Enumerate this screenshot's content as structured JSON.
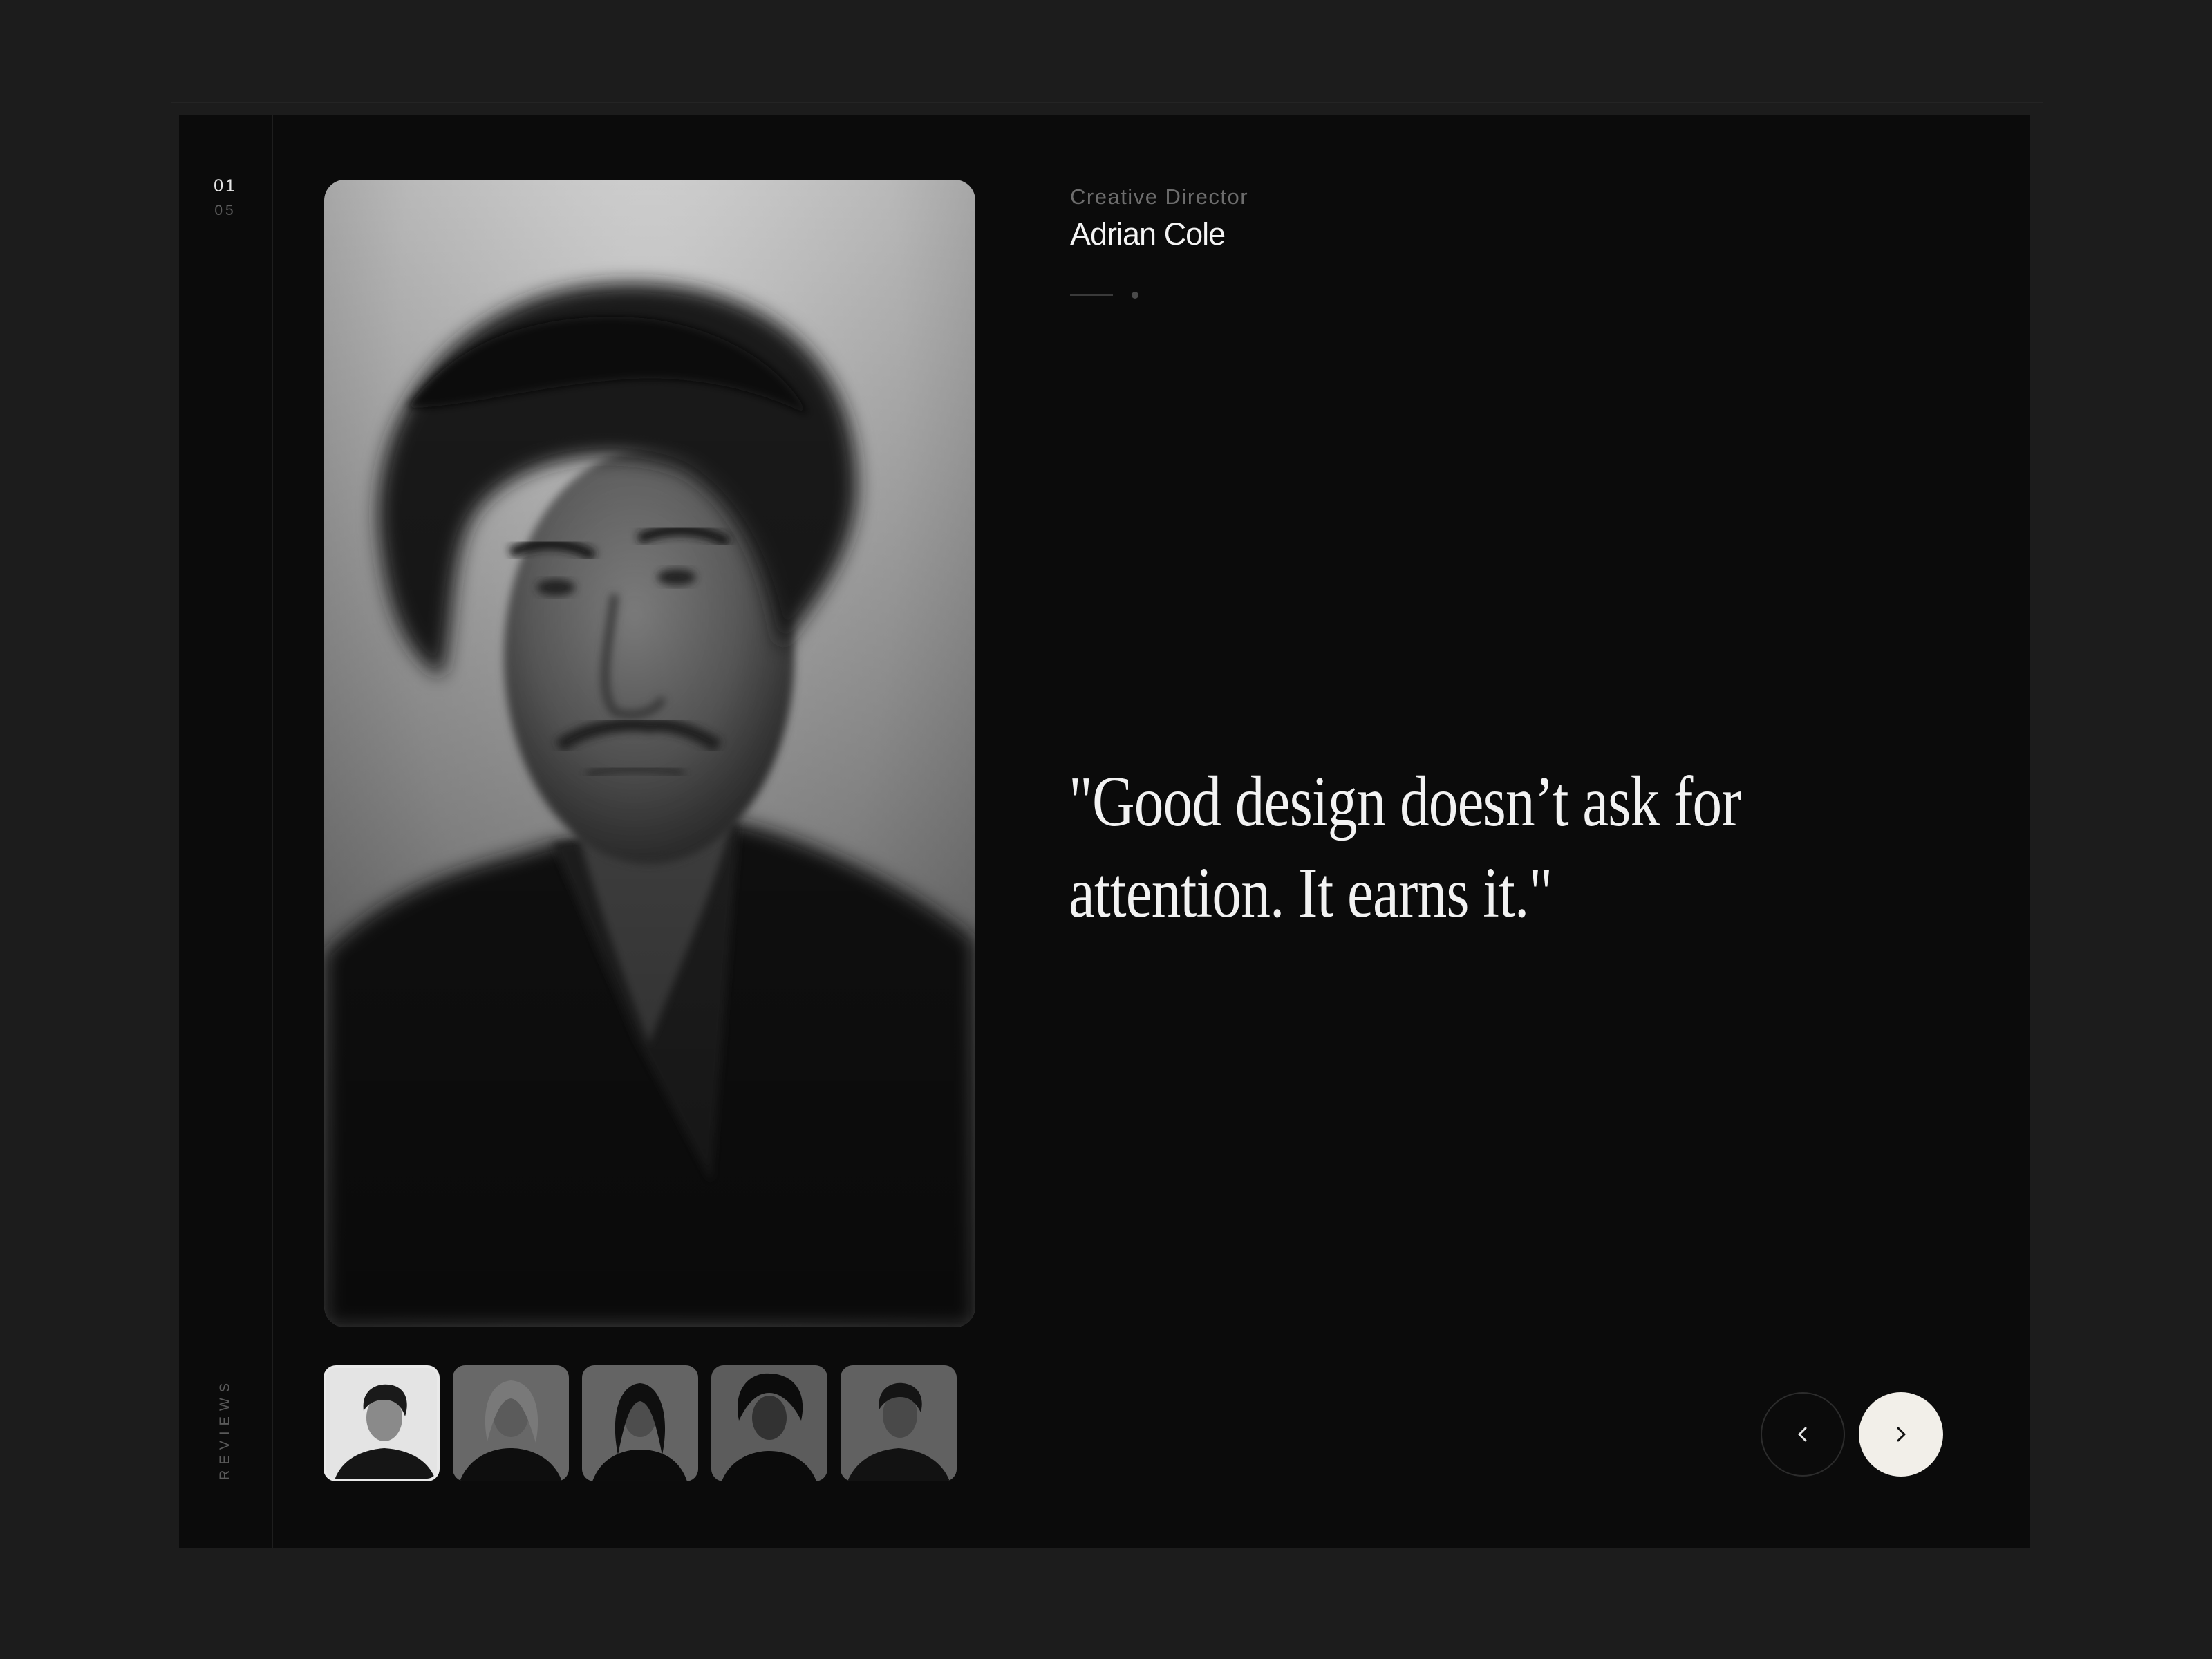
{
  "slider": {
    "current": "01",
    "total": "05",
    "section_label": "REVIEWS"
  },
  "testimonial": {
    "role": "Creative Director",
    "name": "Adrian Cole",
    "quote": "\"Good design doesn’t ask for attention. It earns it.\""
  },
  "thumbnails": [
    {
      "person": "Adrian Cole",
      "active": true
    },
    {
      "person": "reviewer-2",
      "active": false
    },
    {
      "person": "reviewer-3",
      "active": false
    },
    {
      "person": "reviewer-4",
      "active": false
    },
    {
      "person": "reviewer-5",
      "active": false
    }
  ],
  "navigation": {
    "prev_icon": "chevron-left-icon",
    "next_icon": "chevron-right-icon"
  },
  "colors": {
    "page_background": "#1c1c1c",
    "panel_background": "#0b0b0b",
    "next_button": "#f2efe9",
    "text_primary": "#f2f2f2",
    "text_muted": "#6d6d6d"
  }
}
